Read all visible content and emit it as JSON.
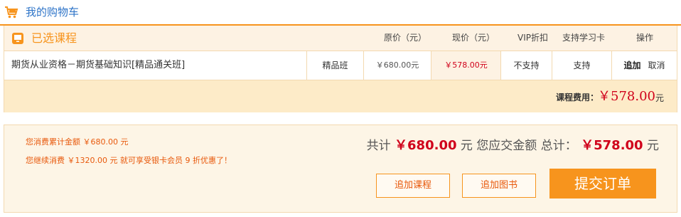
{
  "header": {
    "title": "我的购物车",
    "icon": "shopping-cart-icon",
    "accent": "#f7941d",
    "title_color": "#2e74c8"
  },
  "course_table": {
    "section_title": "已选课程",
    "columns": {
      "original_price": "原价（元）",
      "current_price": "现价（元）",
      "vip_discount": "VIP折扣",
      "study_card": "支持学习卡",
      "actions": "操作"
    },
    "rows": [
      {
        "name": "期货从业资格－期货基础知识[精品通关班]",
        "class_type": "精品班",
        "original_price": "￥680.00元",
        "current_price": "￥578.00元",
        "vip_discount": "不支持",
        "study_card": "支持",
        "action_add": "追加",
        "action_cancel": "取消"
      }
    ],
    "fee_label": "课程费用：",
    "fee_value": "￥578.00",
    "fee_unit": "元"
  },
  "summary": {
    "note1": "您消费累计金额 ￥680.00 元",
    "note2": "您继续消费 ￥1320.00 元 就可享受银卡会员 9 折优惠了！",
    "total_prefix": "共计 ",
    "total_value": "￥680.00",
    "total_mid": " 元 您应交金额 总计： ",
    "due_value": "￥578.00",
    "due_unit": " 元",
    "btn_add_course": "追加课程",
    "btn_add_book": "追加图书",
    "btn_submit": "提交订单"
  }
}
